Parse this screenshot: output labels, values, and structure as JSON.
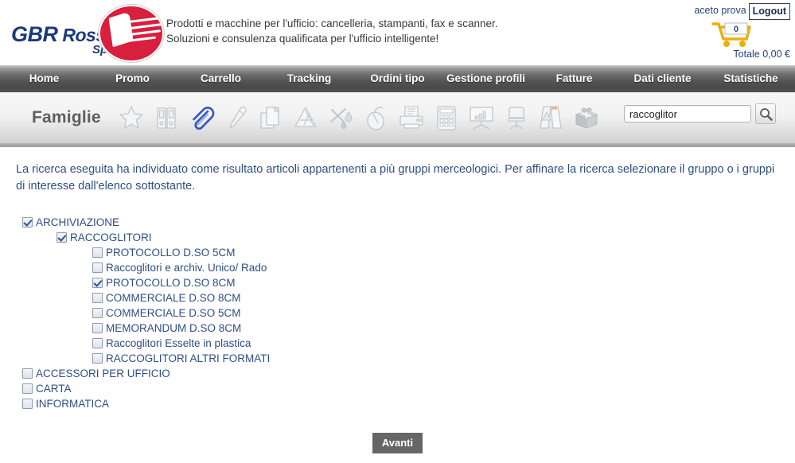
{
  "header": {
    "logo": {
      "line1_bold": "GBR",
      "line1_rest": " Rossetto",
      "line2": "Spa",
      "brand_blue": "#1c3a7b",
      "brand_red": "#d81f3e"
    },
    "tagline_line1": "Prodotti e macchine per l'ufficio: cancelleria, stampanti, fax e scanner.",
    "tagline_line2": "Soluzioni e consulenza qualificata per l'ufficio intelligente!",
    "user_name": "aceto prova",
    "logout_label": "Logout",
    "cart_count": "0",
    "cart_total": "Totale 0,00 €"
  },
  "nav": {
    "items": [
      {
        "label": "Home"
      },
      {
        "label": "Promo"
      },
      {
        "label": "Carrello"
      },
      {
        "label": "Tracking"
      },
      {
        "label": "Ordini tipo"
      },
      {
        "label": "Gestione profili"
      },
      {
        "label": "Fatture"
      },
      {
        "label": "Dati cliente"
      },
      {
        "label": "Statistiche"
      }
    ]
  },
  "families": {
    "label": "Famiglie",
    "active_index": 2,
    "active_color": "#2a55c8",
    "icons": [
      {
        "name": "star-icon"
      },
      {
        "name": "binders-icon"
      },
      {
        "name": "paperclip-icon"
      },
      {
        "name": "marker-pen-icon"
      },
      {
        "name": "paper-sheets-icon"
      },
      {
        "name": "drafting-set-icon"
      },
      {
        "name": "art-supplies-icon"
      },
      {
        "name": "computer-mouse-icon"
      },
      {
        "name": "printer-icon"
      },
      {
        "name": "calculator-icon"
      },
      {
        "name": "presentation-board-icon"
      },
      {
        "name": "office-chair-icon"
      },
      {
        "name": "caution-sign-icon"
      },
      {
        "name": "gift-box-icon"
      }
    ]
  },
  "search": {
    "value": "raccoglitor",
    "placeholder": "",
    "button_icon": "search-icon"
  },
  "main": {
    "intro": "La ricerca eseguita ha individuato come risultato articoli appartenenti a più gruppi merceologici. Per affinare la ricerca selezionare il gruppo o i gruppi di interesse dall'elenco sottostante.",
    "tree": [
      {
        "label": "ARCHIVIAZIONE",
        "level": 0,
        "checked": true
      },
      {
        "label": "RACCOGLITORI",
        "level": 1,
        "checked": true
      },
      {
        "label": "PROTOCOLLO D.SO 5CM",
        "level": 2,
        "checked": false
      },
      {
        "label": "Raccoglitori e archiv. Unico/ Rado",
        "level": 2,
        "checked": false
      },
      {
        "label": "PROTOCOLLO D.SO 8CM",
        "level": 2,
        "checked": true
      },
      {
        "label": "COMMERCIALE D.SO 8CM",
        "level": 2,
        "checked": false
      },
      {
        "label": "COMMERCIALE D.SO 5CM",
        "level": 2,
        "checked": false
      },
      {
        "label": "MEMORANDUM D.SO 8CM",
        "level": 2,
        "checked": false
      },
      {
        "label": "Raccoglitori Esselte in plastica",
        "level": 2,
        "checked": false
      },
      {
        "label": "RACCOGLITORI ALTRI FORMATI",
        "level": 2,
        "checked": false
      },
      {
        "label": "ACCESSORI PER UFFICIO",
        "level": 0,
        "checked": false
      },
      {
        "label": "CARTA",
        "level": 0,
        "checked": false
      },
      {
        "label": "INFORMATICA",
        "level": 0,
        "checked": false
      }
    ],
    "submit_label": "Avanti"
  }
}
